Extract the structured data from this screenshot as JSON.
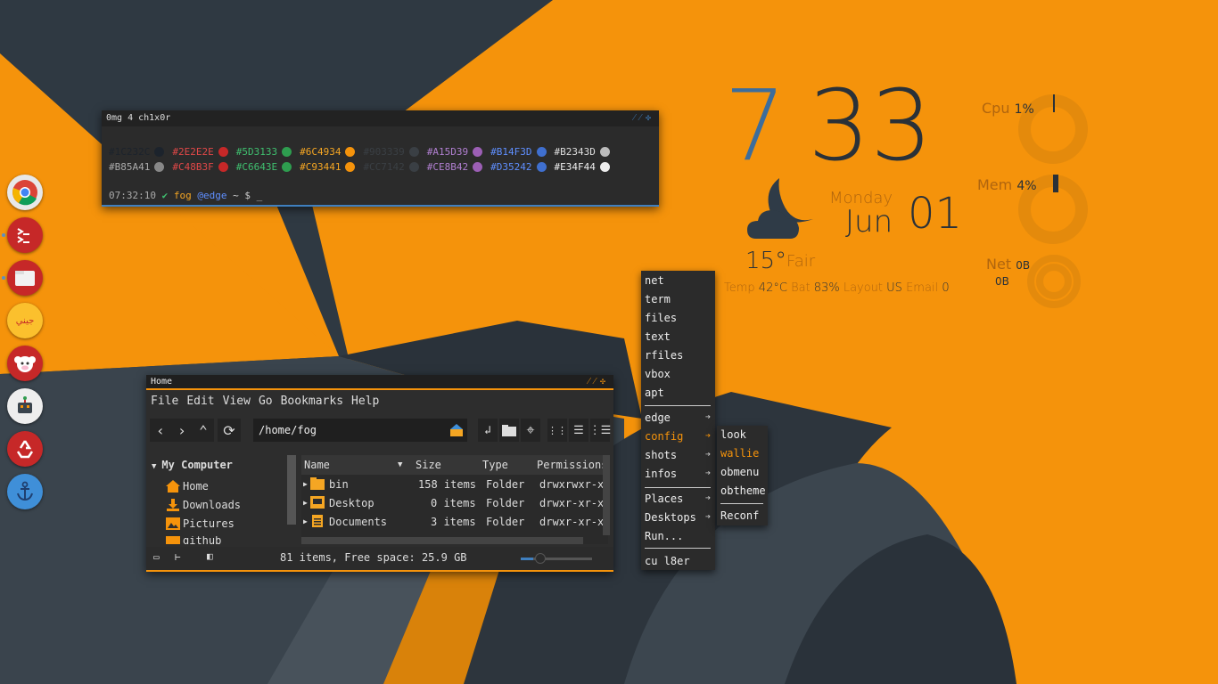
{
  "dock": {
    "items": [
      {
        "name": "chrome",
        "color": "#e8e8e8"
      },
      {
        "name": "terminal",
        "color": "#c62828"
      },
      {
        "name": "files",
        "color": "#c62828"
      },
      {
        "name": "notes",
        "color": "#fbc02d",
        "text": "جيني"
      },
      {
        "name": "monkey",
        "color": "#c62828"
      },
      {
        "name": "robot",
        "color": "#eeeeee"
      },
      {
        "name": "recycle",
        "color": "#c62828"
      },
      {
        "name": "anchor",
        "color": "#3f8fd8"
      }
    ]
  },
  "terminal": {
    "title": "0mg 4 ch1x0r",
    "row1": [
      {
        "hex": "#1C232C",
        "color": "#1C232C"
      },
      {
        "hex": "#2E2E2E",
        "color": "#c62828"
      },
      {
        "hex": "#5D3133",
        "color": "#2e9d4f"
      },
      {
        "hex": "#6C4934",
        "color": "#f5930b"
      },
      {
        "hex": "#903339",
        "color": "#3a3f44"
      },
      {
        "hex": "#A15D39",
        "color": "#9c5fb5"
      },
      {
        "hex": "#B14F3D",
        "color": "#3f6fcf"
      },
      {
        "hex": "#B2343D",
        "color": "#bbbbbb"
      }
    ],
    "row2": [
      {
        "hex": "#B85A41",
        "color": "#888888"
      },
      {
        "hex": "#C48B3F",
        "color": "#c62828"
      },
      {
        "hex": "#C6643E",
        "color": "#2e9d4f"
      },
      {
        "hex": "#C93441",
        "color": "#f5930b"
      },
      {
        "hex": "#CC7142",
        "color": "#3a3f44"
      },
      {
        "hex": "#CE8B42",
        "color": "#9c5fb5"
      },
      {
        "hex": "#D35242",
        "color": "#3f6fcf"
      },
      {
        "hex": "#E34F44",
        "color": "#eeeeee"
      }
    ],
    "text_colors_row1": [
      "#1C232C",
      "#e04848",
      "#3fbf6f",
      "#f5a623",
      "#3a3f44",
      "#b07fd0",
      "#5f8fff",
      "#dddddd"
    ],
    "text_colors_row2": [
      "#aaaaaa",
      "#e04848",
      "#3fbf6f",
      "#f5a623",
      "#3a3f44",
      "#b07fd0",
      "#5f8fff",
      "#eeeeee"
    ],
    "prompt": {
      "time": "07:32:10",
      "check": "✔",
      "user": "fog",
      "host": "@edge",
      "path": "~",
      "symbol": "$",
      "cursor": "_"
    }
  },
  "clock": {
    "hour": "7",
    "minute": "33",
    "weekday": "Monday",
    "month": "Jun",
    "day": "01",
    "temp": "15°",
    "condition": "Fair",
    "status": {
      "temp_label": "Temp",
      "temp_val": "42°C",
      "bat_label": "Bat",
      "bat_val": "83%",
      "layout_label": "Layout",
      "layout_val": "US",
      "email_label": "Email",
      "email_val": "0"
    }
  },
  "system": {
    "cpu_label": "Cpu",
    "cpu_val": "1%",
    "mem_label": "Mem",
    "mem_val": "4%",
    "net_label": "Net",
    "net_down": "0B",
    "net_up": "0B"
  },
  "filemanager": {
    "title": "Home",
    "menu": [
      "File",
      "Edit",
      "View",
      "Go",
      "Bookmarks",
      "Help"
    ],
    "path": "/home/fog",
    "sidebar": {
      "heading": "My Computer",
      "items": [
        "Home",
        "Downloads",
        "Pictures",
        "github"
      ]
    },
    "columns": [
      "Name",
      "Size",
      "Type",
      "Permissions"
    ],
    "rows": [
      {
        "name": "bin",
        "size": "158 items",
        "type": "Folder",
        "perm": "drwxrwxr-x"
      },
      {
        "name": "Desktop",
        "size": "0 items",
        "type": "Folder",
        "perm": "drwxr-xr-x"
      },
      {
        "name": "Documents",
        "size": "3 items",
        "type": "Folder",
        "perm": "drwxr-xr-x"
      }
    ],
    "status": "81 items, Free space: 25.9 GB",
    "accent": "#f5930b"
  },
  "menu": {
    "items_top": [
      "net",
      "term",
      "files",
      "text",
      "rfiles",
      "vbox",
      "apt"
    ],
    "items_mid": [
      "edge",
      "config",
      "shots",
      "infos"
    ],
    "items_places": [
      "Places",
      "Desktops",
      "Run..."
    ],
    "exit": "cu l8er",
    "submenu": [
      "look",
      "wallie",
      "obmenu",
      "obtheme"
    ],
    "submenu_last": "Reconf"
  }
}
